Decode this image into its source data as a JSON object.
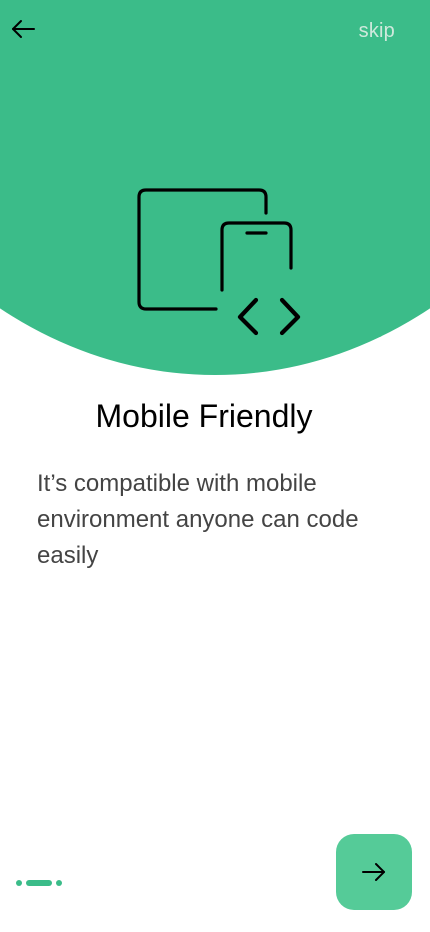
{
  "header": {
    "back_icon": "arrow-left-icon",
    "skip_label": "skip"
  },
  "hero": {
    "illustration_icon": "devices-code-icon",
    "background_color": "#3bbc89"
  },
  "content": {
    "title": "Mobile Friendly",
    "description": "It’s compatible with mobile environment anyone can code easily"
  },
  "pagination": {
    "total_steps": 3,
    "current_step": 2
  },
  "footer": {
    "next_icon": "arrow-right-icon",
    "button_color": "#55cb98"
  }
}
